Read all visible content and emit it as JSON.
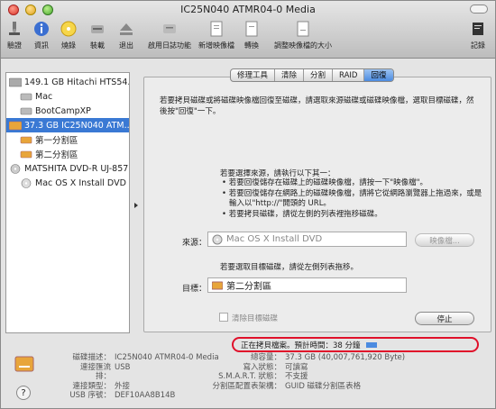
{
  "window": {
    "title": "IC25N040 ATMR04-0 Media"
  },
  "toolbar": {
    "items": [
      {
        "label": "驗證",
        "icon": "microscope-icon"
      },
      {
        "label": "資訊",
        "icon": "info-icon"
      },
      {
        "label": "燒錄",
        "icon": "burn-icon"
      },
      {
        "label": "裝載",
        "icon": "mount-icon"
      },
      {
        "label": "退出",
        "icon": "eject-icon"
      },
      {
        "label": "啟用日誌功能",
        "icon": "journal-icon"
      },
      {
        "label": "新增映像檔",
        "icon": "new-image-icon"
      },
      {
        "label": "轉換",
        "icon": "convert-icon"
      },
      {
        "label": "調整映像檔的大小",
        "icon": "resize-image-icon"
      },
      {
        "label": "記錄",
        "icon": "log-icon"
      }
    ]
  },
  "sidebar": {
    "items": [
      {
        "label": "149.1 GB Hitachi HTS54...",
        "icon": "hard-disk-icon",
        "indent": 0,
        "selected": false
      },
      {
        "label": "Mac",
        "icon": "volume-icon",
        "indent": 1,
        "selected": false
      },
      {
        "label": "BootCampXP",
        "icon": "volume-icon",
        "indent": 1,
        "selected": false
      },
      {
        "label": "37.3 GB IC25N040 ATM...",
        "icon": "external-disk-icon",
        "indent": 0,
        "selected": true
      },
      {
        "label": "第一分割區",
        "icon": "volume-icon",
        "indent": 1,
        "selected": false
      },
      {
        "label": "第二分割區",
        "icon": "volume-icon",
        "indent": 1,
        "selected": false
      },
      {
        "label": "MATSHITA DVD-R UJ-857",
        "icon": "optical-drive-icon",
        "indent": 0,
        "selected": false
      },
      {
        "label": "Mac OS X Install DVD",
        "icon": "dvd-icon",
        "indent": 1,
        "selected": false
      }
    ]
  },
  "tabs": [
    {
      "label": "修理工具",
      "active": false
    },
    {
      "label": "清除",
      "active": false
    },
    {
      "label": "分割",
      "active": false
    },
    {
      "label": "RAID",
      "active": false
    },
    {
      "label": "回復",
      "active": true
    }
  ],
  "restore": {
    "description": "若要拷貝磁碟或將磁碟映像檔回復至磁碟，請選取來源磁碟或磁碟映像檔，選取目標磁碟，然後按\"回復\"一下。",
    "source_instruction": "若要選擇來源，請執行以下其一：",
    "bullets": [
      "若要回復儲存在磁碟上的磁碟映像檔，請按一下\"映像檔\"。",
      "若要回復儲存在網路上的磁碟映像檔，請將它從網路瀏覽器上拖過來，或是輸入以\"http://\"開頭的 URL。",
      "若要拷貝磁碟，請從左側的列表裡拖移磁碟。"
    ],
    "source_label": "來源：",
    "source_value": "Mac OS X Install DVD",
    "image_button": "映像檔...",
    "dest_instruction": "若要選取目標磁碟，請從左側列表拖移。",
    "dest_label": "目標：",
    "dest_value": "第二分割區",
    "erase_label": "清除目標磁碟",
    "stop_button": "停止"
  },
  "progress": {
    "text": "正在拷貝檔案。預計時間：38 分鐘",
    "fraction": 0.05
  },
  "info": {
    "left": [
      {
        "k": "磁碟描述：",
        "v": "IC25N040 ATMR04-0 Media"
      },
      {
        "k": "連接匯流排：",
        "v": "USB"
      },
      {
        "k": "連接類型：",
        "v": "外接"
      },
      {
        "k": "USB 序號：",
        "v": "DEF10AA8B14B"
      }
    ],
    "right": [
      {
        "k": "總容量：",
        "v": "37.3 GB (40,007,761,920 Byte)"
      },
      {
        "k": "寫入狀態：",
        "v": "可讀寫"
      },
      {
        "k": "S.M.A.R.T. 狀態：",
        "v": "不支援"
      },
      {
        "k": "分割區配置表架構：",
        "v": "GUID 磁碟分割區表格"
      }
    ]
  },
  "colors": {
    "selection": "#3a79d4",
    "highlight_ring": "#e0102a"
  }
}
